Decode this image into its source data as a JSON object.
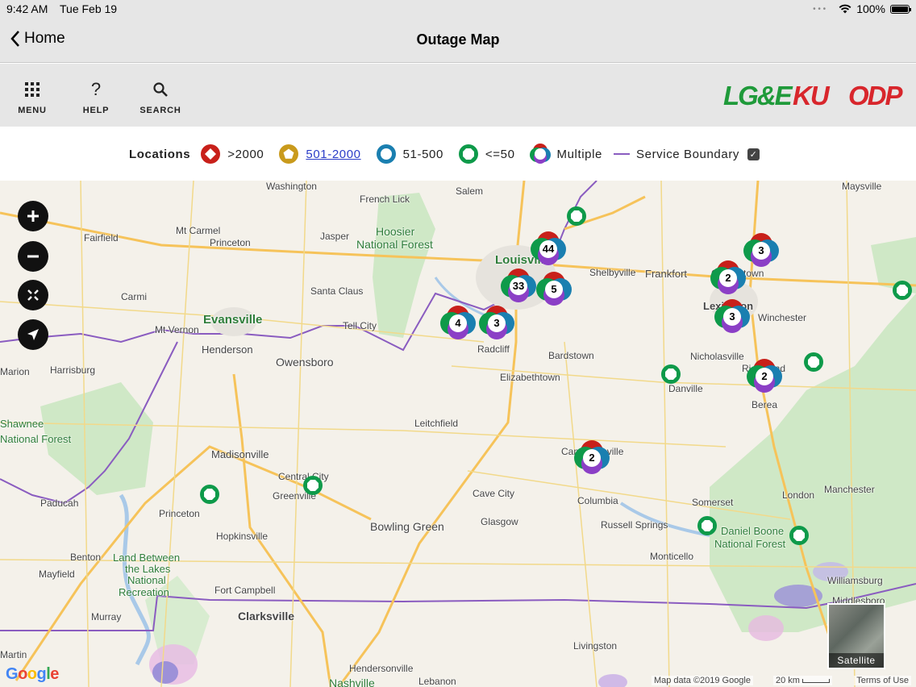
{
  "status_bar": {
    "time": "9:42 AM",
    "date": "Tue Feb 19",
    "battery": "100%"
  },
  "nav": {
    "back_label": "Home",
    "title": "Outage Map"
  },
  "toolbar": {
    "menu_label": "MENU",
    "help_label": "HELP",
    "search_label": "SEARCH"
  },
  "logos": {
    "lge": "LG&E",
    "ku": "KU",
    "odp": "ODP"
  },
  "legend": {
    "heading": "Locations",
    "items": [
      ">2000",
      "501-2000",
      "51-500",
      "<=50",
      "Multiple",
      "Service Boundary"
    ],
    "service_boundary_checked": true
  },
  "colors": {
    "over2000": "#c8201a",
    "r501_2000": "#c99a1c",
    "r51_500": "#1a7fb0",
    "le50": "#0e9a4a",
    "multi_purple": "#8b3fc6",
    "boundary": "#8a5cc0"
  },
  "map": {
    "places": [
      {
        "name": "French Lick"
      },
      {
        "name": "Salem"
      },
      {
        "name": "Hoosier"
      },
      {
        "name": "National Forest"
      },
      {
        "name": "Fairfield"
      },
      {
        "name": "Mt Carmel"
      },
      {
        "name": "Princeton"
      },
      {
        "name": "Jasper"
      },
      {
        "name": "Louisville"
      },
      {
        "name": "Shelbyville"
      },
      {
        "name": "Frankfort"
      },
      {
        "name": "Georgetown"
      },
      {
        "name": "Carmi"
      },
      {
        "name": "Santa Claus"
      },
      {
        "name": "Evansville"
      },
      {
        "name": "Mt Vernon"
      },
      {
        "name": "Tell City"
      },
      {
        "name": "Henderson"
      },
      {
        "name": "Owensboro"
      },
      {
        "name": "Radcliff"
      },
      {
        "name": "Bardstown"
      },
      {
        "name": "Elizabethtown"
      },
      {
        "name": "Lexington"
      },
      {
        "name": "Winchester"
      },
      {
        "name": "Nicholasville"
      },
      {
        "name": "Richmond"
      },
      {
        "name": "Danville"
      },
      {
        "name": "Berea"
      },
      {
        "name": "Harrisburg"
      },
      {
        "name": "Shawnee"
      },
      {
        "name": "National Forest"
      },
      {
        "name": "Leitchfield"
      },
      {
        "name": "Madisonville"
      },
      {
        "name": "Central City"
      },
      {
        "name": "Greenville"
      },
      {
        "name": "Campbellsville"
      },
      {
        "name": "Paducah"
      },
      {
        "name": "Princeton"
      },
      {
        "name": "Cave City"
      },
      {
        "name": "Columbia"
      },
      {
        "name": "Glasgow"
      },
      {
        "name": "Bowling Green"
      },
      {
        "name": "Russell Springs"
      },
      {
        "name": "Somerset"
      },
      {
        "name": "London"
      },
      {
        "name": "Manchester"
      },
      {
        "name": "Daniel Boone"
      },
      {
        "name": "National Forest"
      },
      {
        "name": "Benton"
      },
      {
        "name": "Mayfield"
      },
      {
        "name": "Land Between"
      },
      {
        "name": "the Lakes"
      },
      {
        "name": "National"
      },
      {
        "name": "Recreation"
      },
      {
        "name": "Hopkinsville"
      },
      {
        "name": "Fort Campbell"
      },
      {
        "name": "Monticello"
      },
      {
        "name": "Williamsburg"
      },
      {
        "name": "Middlesboro"
      },
      {
        "name": "Murray"
      },
      {
        "name": "Clarksville"
      },
      {
        "name": "Martin"
      },
      {
        "name": "Hendersonville"
      },
      {
        "name": "Livingston"
      },
      {
        "name": "Lebanon"
      },
      {
        "name": "Nashville"
      },
      {
        "name": "Marion"
      },
      {
        "name": "Maysville"
      },
      {
        "name": "Washington"
      }
    ],
    "clusters": [
      {
        "count": "44"
      },
      {
        "count": "33"
      },
      {
        "count": "5"
      },
      {
        "count": "4"
      },
      {
        "count": "3"
      },
      {
        "count": "3"
      },
      {
        "count": "2"
      },
      {
        "count": "3"
      },
      {
        "count": "2"
      },
      {
        "count": "2"
      }
    ],
    "single_outages": 8,
    "attribution": "Map data ©2019 Google",
    "scale": "20 km",
    "terms": "Terms of Use",
    "satellite_label": "Satellite",
    "google": "Google"
  }
}
